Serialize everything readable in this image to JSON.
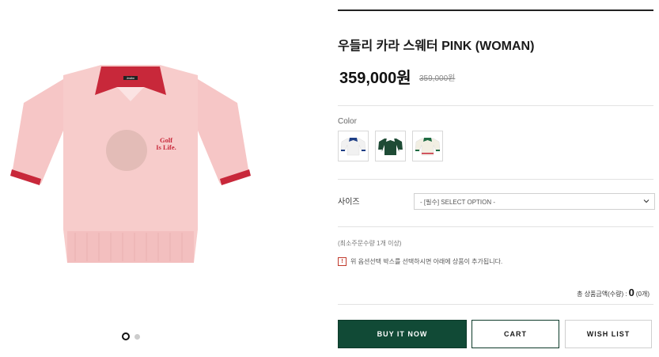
{
  "product": {
    "title": "우들리 카라 스웨터 PINK (WOMAN)",
    "price": "359,000원",
    "original_price": "359,000원",
    "image_text": "Golf Is Life.",
    "collar_label": "Jmdbn"
  },
  "options": {
    "color_label": "Color",
    "colors": [
      {
        "name": "white-navy",
        "body": "#f1f1f1",
        "trim": "#1f3f86"
      },
      {
        "name": "green",
        "body": "#1e4b35",
        "trim": "#ffffff"
      },
      {
        "name": "cream-green",
        "body": "#f2efe3",
        "trim": "#1f6b43"
      }
    ],
    "size_label": "사이즈",
    "size_select_value": "- [필수] SELECT OPTION -"
  },
  "info": {
    "min_qty": "(최소주문수량 1개 이상)",
    "notice": "위 옵션선택 박스를 선택하시면 아래에 상품이 추가됩니다.",
    "total_label": "총 상품금액(수량) :",
    "total_value": "0",
    "total_count": "(0개)"
  },
  "buttons": {
    "buy": "BUY IT NOW",
    "cart": "CART",
    "wish": "WISH LIST"
  },
  "gallery": {
    "image_count": 2,
    "active_index": 0
  },
  "colors": {
    "accent": "#114a36",
    "sweater": "#f6c6c6",
    "trim": "#c8283a"
  }
}
